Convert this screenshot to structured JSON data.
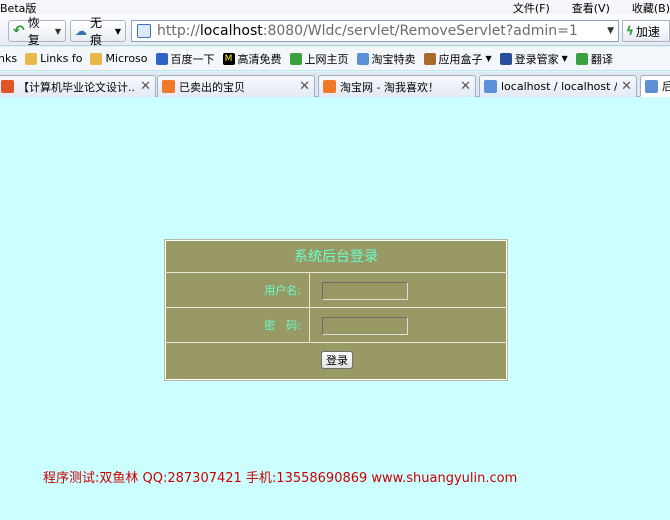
{
  "titlebar": {
    "app_title": "Beta版",
    "menu": [
      "文件(F)",
      "查看(V)",
      "收藏(B)"
    ]
  },
  "navbar": {
    "back_label": "恢复",
    "trace_label": "无痕",
    "address": {
      "protocol": "http://",
      "host": "localhost",
      "rest": ":8080/Wldc/servlet/RemoveServlet?admin=1"
    },
    "speed_label": "加速"
  },
  "bookmarks": [
    {
      "label": "nks",
      "icon": "none",
      "color": ""
    },
    {
      "label": "Links fo",
      "icon": "folder-icon",
      "color": "#e8b84a"
    },
    {
      "label": "Microso",
      "icon": "folder-icon",
      "color": "#e8b84a"
    },
    {
      "label": "百度一下",
      "icon": "baidu-icon",
      "color": "#2f63c9"
    },
    {
      "label": "高清免费",
      "icon": "m-logo-icon",
      "color": "#000000"
    },
    {
      "label": "上网主页",
      "icon": "home-icon",
      "color": "#3aa040"
    },
    {
      "label": "淘宝特卖",
      "icon": "page-icon",
      "color": "#5b8fd6"
    },
    {
      "label": "应用盒子",
      "icon": "box-icon",
      "color": "#a86a2a"
    },
    {
      "label": "登录管家",
      "icon": "key-icon",
      "color": "#2a4f9a"
    },
    {
      "label": "翻译",
      "icon": "translate-icon",
      "color": "#3aa040"
    }
  ],
  "tabs": [
    {
      "label": "【计算机毕业论文设计..."
    },
    {
      "label": "已卖出的宝贝"
    },
    {
      "label": "淘宝网 - 淘我喜欢！"
    },
    {
      "label": "localhost / localhost /..."
    },
    {
      "label": "后"
    }
  ],
  "login": {
    "title": "系统后台登录",
    "username_label": "用户名:",
    "password_label": "密　码:",
    "username_value": "",
    "password_value": "",
    "submit_label": "登录"
  },
  "footer": {
    "text": "程序测试:双鱼林 QQ:287307421 手机:13558690869 www.shuangyulin.com"
  },
  "colors": {
    "page_bg": "#ccffff",
    "login_bg": "#999966",
    "login_text": "#66ffcc",
    "footer_text": "#cc0000"
  }
}
